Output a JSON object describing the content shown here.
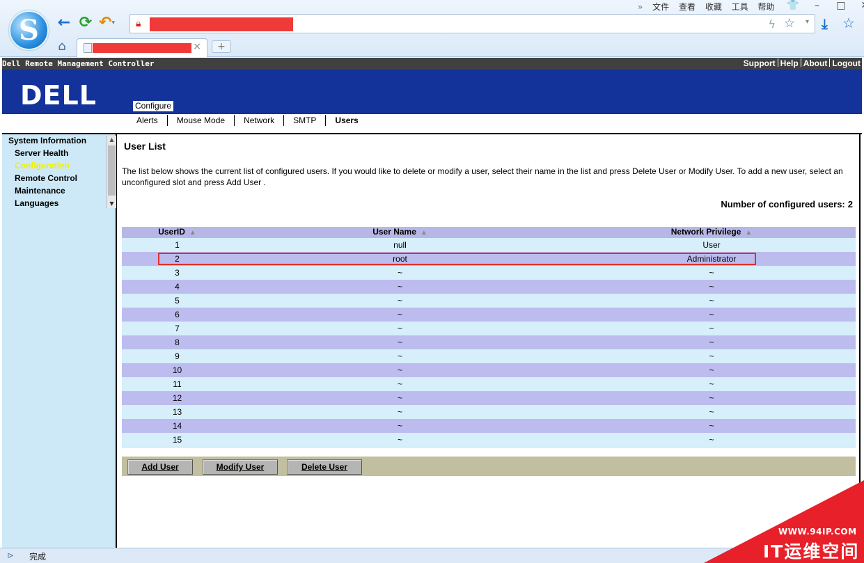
{
  "browser": {
    "menu": [
      "文件",
      "查看",
      "收藏",
      "工具",
      "帮助"
    ],
    "more_glyph": "»",
    "window_controls": [
      "👕",
      "–",
      "□",
      "✕"
    ],
    "tab_close": "×",
    "new_tab": "+",
    "status_text": "完成",
    "icons": [
      "logo-s-icon",
      "back-icon",
      "reload-icon",
      "undo-icon",
      "home-icon",
      "lock-icon",
      "bolt-icon",
      "star-icon",
      "download-icon",
      "favorites-icon"
    ]
  },
  "app": {
    "title": "Dell Remote Management Controller",
    "top_links": [
      "Support",
      "Help",
      "About",
      "Logout"
    ],
    "logo_text": "DELL",
    "active_section": "Configure",
    "subnav": [
      "Alerts",
      "Mouse Mode",
      "Network",
      "SMTP",
      "Users"
    ],
    "subnav_active": "Users"
  },
  "sidebar": {
    "items": [
      {
        "label": "System Information",
        "level": "top"
      },
      {
        "label": "Server Health",
        "level": "child"
      },
      {
        "label": "Configuration",
        "level": "child",
        "active": true
      },
      {
        "label": "Remote Control",
        "level": "child"
      },
      {
        "label": "Maintenance",
        "level": "child"
      },
      {
        "label": "Languages",
        "level": "child"
      }
    ]
  },
  "main": {
    "title": "User List",
    "description": "The list below shows the current list of configured users. If you would like to delete or modify a user, select their name in the list and press Delete User or Modify User. To add a new user, select an unconfigured slot and press Add User .",
    "count_label": "Number of configured users:",
    "count_value": "2",
    "table": {
      "columns": [
        "UserID",
        "User Name",
        "Network Privilege"
      ],
      "sort_glyph": "▲",
      "rows": [
        [
          "1",
          "null",
          "User"
        ],
        [
          "2",
          "root",
          "Administrator"
        ],
        [
          "3",
          "~",
          "~"
        ],
        [
          "4",
          "~",
          "~"
        ],
        [
          "5",
          "~",
          "~"
        ],
        [
          "6",
          "~",
          "~"
        ],
        [
          "7",
          "~",
          "~"
        ],
        [
          "8",
          "~",
          "~"
        ],
        [
          "9",
          "~",
          "~"
        ],
        [
          "10",
          "~",
          "~"
        ],
        [
          "11",
          "~",
          "~"
        ],
        [
          "12",
          "~",
          "~"
        ],
        [
          "13",
          "~",
          "~"
        ],
        [
          "14",
          "~",
          "~"
        ],
        [
          "15",
          "~",
          "~"
        ]
      ],
      "highlighted_row": 2
    },
    "buttons": [
      "Add User",
      "Modify User",
      "Delete User"
    ]
  },
  "watermark": {
    "url": "WWW.94IP.COM",
    "brand": "IT运维空间",
    "color": "#e8202a"
  }
}
